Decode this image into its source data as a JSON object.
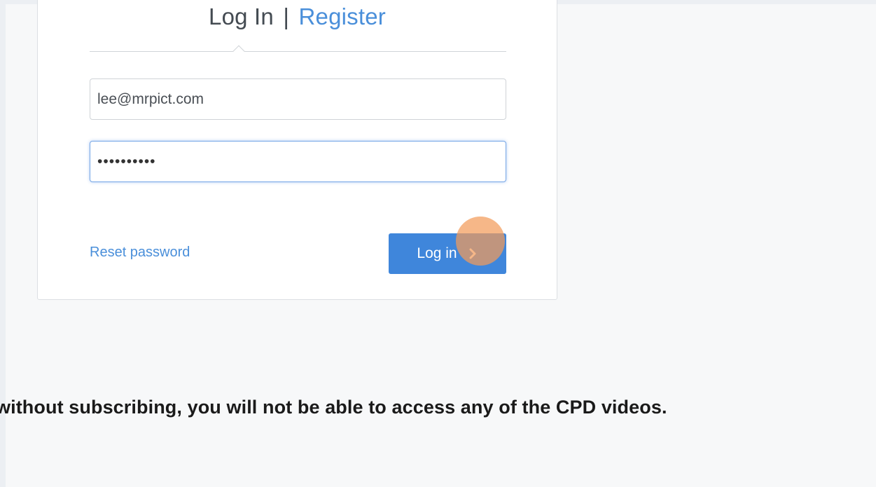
{
  "login_card": {
    "tab_login": "Log In",
    "tab_separator": "|",
    "tab_register": "Register",
    "email_value": "lee@mrpict.com",
    "password_value": "••••••••••",
    "reset_link": "Reset password",
    "login_button": "Log in",
    "button_icon": "chevron-right-icon"
  },
  "notice_text": "without subscribing, you will not be able to access any of the CPD videos.",
  "colors": {
    "accent": "#4a8fda",
    "button": "#3f86db",
    "click_indicator": "#f29b5a",
    "text_dark": "#1a1a1a"
  }
}
